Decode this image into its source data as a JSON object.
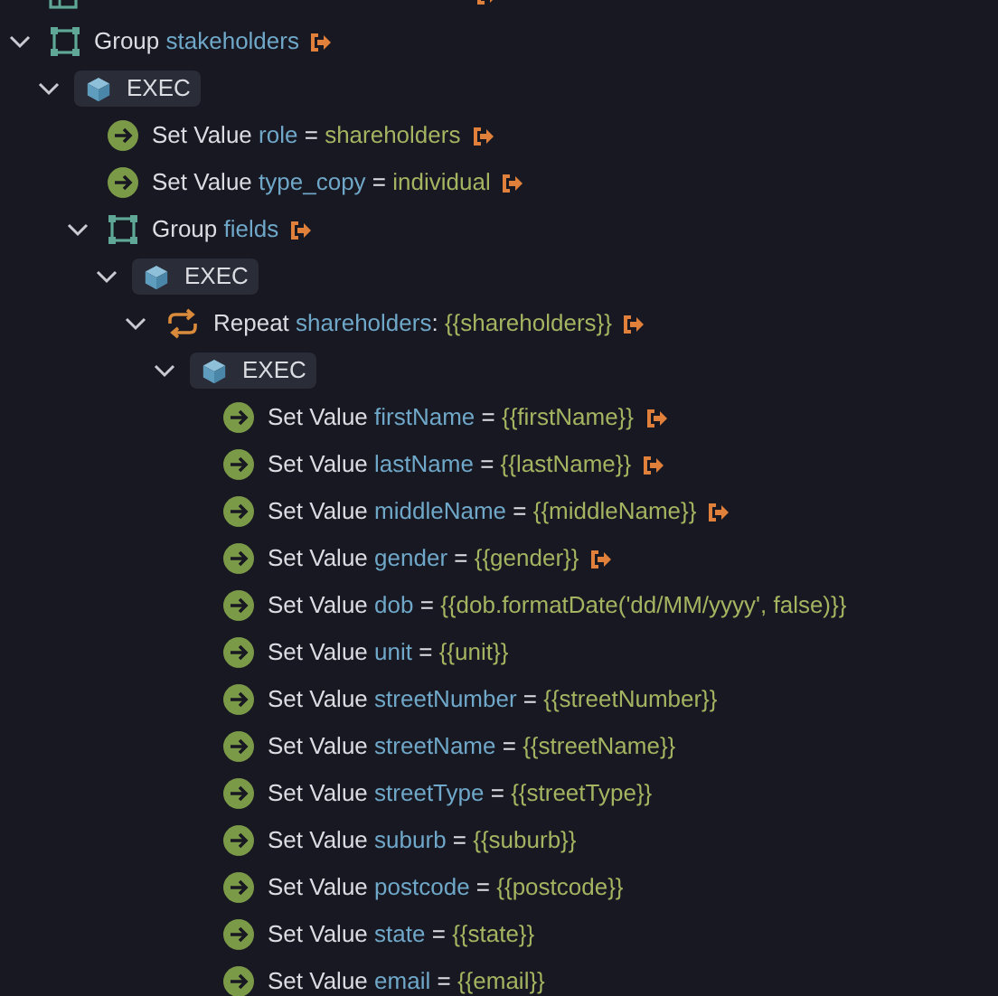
{
  "tree": [
    {
      "kind": "query",
      "link": true
    },
    {
      "kind": "group",
      "label": "Group",
      "name": "stakeholders",
      "link": true,
      "expanded": true,
      "children": [
        {
          "kind": "exec",
          "label": "EXEC",
          "expanded": true,
          "children": [
            {
              "kind": "set",
              "label": "Set Value",
              "name": "role",
              "sep": "=",
              "value": "shareholders",
              "link": true
            },
            {
              "kind": "set",
              "label": "Set Value",
              "name": "type_copy",
              "sep": "=",
              "value": "individual",
              "link": true
            },
            {
              "kind": "group",
              "label": "Group",
              "name": "fields",
              "link": true,
              "expanded": true,
              "children": [
                {
                  "kind": "exec",
                  "label": "EXEC",
                  "expanded": true,
                  "children": [
                    {
                      "kind": "repeat",
                      "label": "Repeat",
                      "name": "shareholders",
                      "sep": ":",
                      "value": "{{shareholders}}",
                      "link": true,
                      "expanded": true,
                      "children": [
                        {
                          "kind": "exec",
                          "label": "EXEC",
                          "expanded": true,
                          "children": [
                            {
                              "kind": "set",
                              "label": "Set Value",
                              "name": "firstName",
                              "sep": "=",
                              "value": "{{firstName}}",
                              "link": true
                            },
                            {
                              "kind": "set",
                              "label": "Set Value",
                              "name": "lastName",
                              "sep": "=",
                              "value": "{{lastName}}",
                              "link": true
                            },
                            {
                              "kind": "set",
                              "label": "Set Value",
                              "name": "middleName",
                              "sep": "=",
                              "value": "{{middleName}}",
                              "link": true
                            },
                            {
                              "kind": "set",
                              "label": "Set Value",
                              "name": "gender",
                              "sep": "=",
                              "value": "{{gender}}",
                              "link": true
                            },
                            {
                              "kind": "set",
                              "label": "Set Value",
                              "name": "dob",
                              "sep": "=",
                              "value": "{{dob.formatDate('dd/MM/yyyy', false)}}",
                              "link": false
                            },
                            {
                              "kind": "set",
                              "label": "Set Value",
                              "name": "unit",
                              "sep": "=",
                              "value": "{{unit}}",
                              "link": false
                            },
                            {
                              "kind": "set",
                              "label": "Set Value",
                              "name": "streetNumber",
                              "sep": "=",
                              "value": "{{streetNumber}}",
                              "link": false
                            },
                            {
                              "kind": "set",
                              "label": "Set Value",
                              "name": "streetName",
                              "sep": "=",
                              "value": "{{streetName}}",
                              "link": false
                            },
                            {
                              "kind": "set",
                              "label": "Set Value",
                              "name": "streetType",
                              "sep": "=",
                              "value": "{{streetType}}",
                              "link": false
                            },
                            {
                              "kind": "set",
                              "label": "Set Value",
                              "name": "suburb",
                              "sep": "=",
                              "value": "{{suburb}}",
                              "link": false
                            },
                            {
                              "kind": "set",
                              "label": "Set Value",
                              "name": "postcode",
                              "sep": "=",
                              "value": "{{postcode}}",
                              "link": false
                            },
                            {
                              "kind": "set",
                              "label": "Set Value",
                              "name": "state",
                              "sep": "=",
                              "value": "{{state}}",
                              "link": false
                            },
                            {
                              "kind": "set",
                              "label": "Set Value",
                              "name": "email",
                              "sep": "=",
                              "value": "{{email}}",
                              "link": false
                            }
                          ]
                        }
                      ]
                    }
                  ]
                }
              ]
            }
          ]
        }
      ]
    }
  ]
}
